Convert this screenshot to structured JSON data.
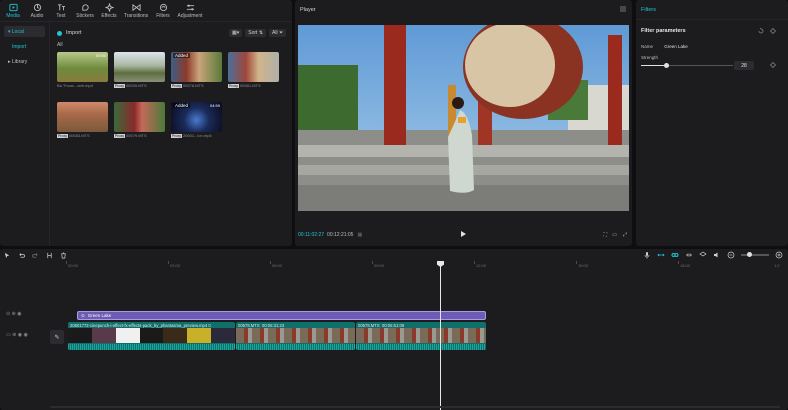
{
  "nav": [
    {
      "label": "Media",
      "icon": "media-icon",
      "active": true
    },
    {
      "label": "Audio",
      "icon": "audio-icon"
    },
    {
      "label": "Text",
      "icon": "text-icon"
    },
    {
      "label": "Stickers",
      "icon": "stickers-icon"
    },
    {
      "label": "Effects",
      "icon": "effects-icon"
    },
    {
      "label": "Transitions",
      "icon": "transitions-icon"
    },
    {
      "label": "Filters",
      "icon": "filters-icon"
    },
    {
      "label": "Adjustment",
      "icon": "adjustment-icon"
    }
  ],
  "sidebar": {
    "local": "Local",
    "import": "Import",
    "library": "Library"
  },
  "media": {
    "import_label": "Import",
    "sort_label": "Sort",
    "all_filter": "All",
    "all_label": "All",
    "thumbs": [
      {
        "name": "Ba Thuoc...anh.mp4",
        "duration": "00:50",
        "tag": "",
        "added": ""
      },
      {
        "name": "00539.MTS",
        "duration": "",
        "tag": "Proxy",
        "added": ""
      },
      {
        "name": "00578.MTS",
        "duration": "",
        "tag": "Proxy",
        "added": "Added"
      },
      {
        "name": "00581.MTS",
        "duration": "",
        "tag": "Proxy",
        "added": ""
      },
      {
        "name": "00583.MTS",
        "duration": "",
        "tag": "Proxy",
        "added": ""
      },
      {
        "name": "00579.MTS",
        "duration": "",
        "tag": "Proxy",
        "added": ""
      },
      {
        "name": "20601...ion.mp4",
        "duration": "04:59",
        "tag": "Proxy",
        "added": "Added"
      }
    ]
  },
  "player": {
    "title": "Player",
    "current_time": "00:11:02:27",
    "total_time": "00:12:21:05"
  },
  "filters": {
    "header": "Filters",
    "params_title": "Filter parameters",
    "name_label": "Name",
    "name_value": "Green Lake",
    "strength_label": "Strength",
    "strength_value": "28",
    "strength_max": 100
  },
  "timeline": {
    "ticks": [
      "00:00",
      "03:00",
      "06:00",
      "09:00",
      "12:00",
      "15:00",
      "18:00",
      "1:2"
    ],
    "filter_clip": "Green Lake",
    "clips": [
      {
        "label": "20601772-cinepunch-i-effect-fx-effects-pack_by_phantasma_preview.mp4",
        "duration": "0",
        "start_pct": 0
      },
      {
        "label": "00578.MTS",
        "duration": "00:05:31:23",
        "start_pct": 0
      },
      {
        "label": "00578.MTS",
        "duration": "00:05:51:09",
        "start_pct": 0
      }
    ]
  },
  "colors": {
    "accent": "#1ec6d6",
    "filter_clip": "#6e5bb6",
    "video_clip": "#0f6f6b",
    "panel": "#1c1c1f"
  }
}
